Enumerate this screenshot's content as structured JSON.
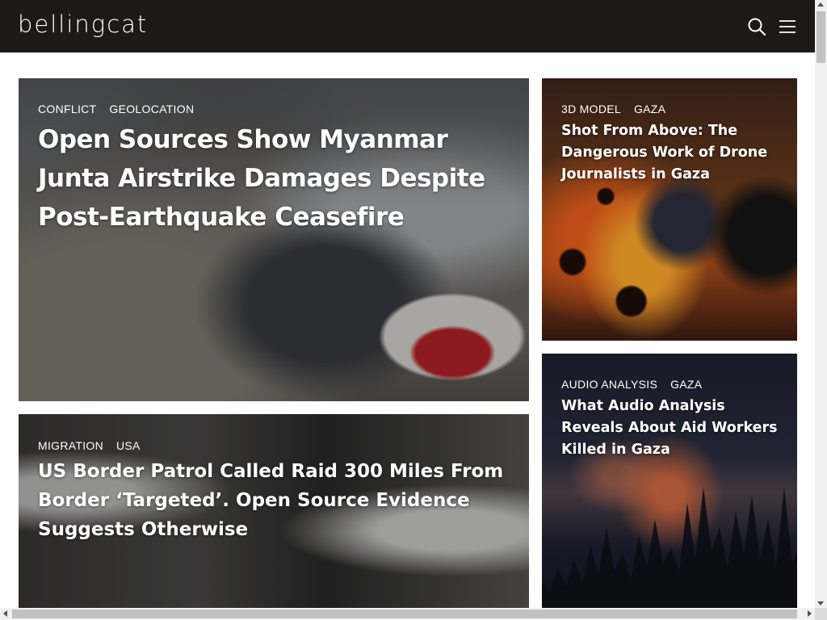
{
  "header": {
    "logo": "bellingcat",
    "background": "#1c1a19",
    "search_icon": "search-icon",
    "menu_icon": "hamburger-menu-icon"
  },
  "cards": [
    {
      "tags": [
        "CONFLICT",
        "GEOLOCATION"
      ],
      "title": "Open Sources Show Myanmar Junta Airstrike Damages Despite Post-Earthquake Ceasefire"
    },
    {
      "tags": [
        "3D MODEL",
        "GAZA"
      ],
      "title": "Shot From Above: The Dangerous Work of Drone Journalists in Gaza"
    },
    {
      "tags": [
        "MIGRATION",
        "USA"
      ],
      "title": "US Border Patrol Called Raid 300 Miles From Border ‘Targeted’. Open Source Evidence Suggests Otherwise"
    },
    {
      "tags": [
        "AUDIO ANALYSIS",
        "GAZA"
      ],
      "title": "What Audio Analysis Reveals About Aid Workers Killed in Gaza"
    }
  ]
}
